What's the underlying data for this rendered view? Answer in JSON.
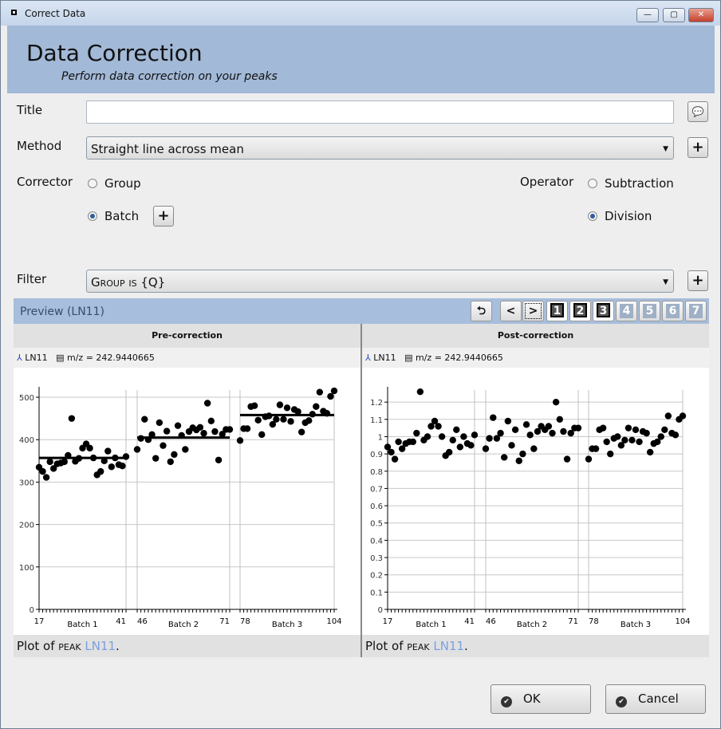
{
  "window": {
    "title": "Correct Data",
    "minimize": "—",
    "maximize": "▢",
    "close": "✕"
  },
  "header": {
    "title": "Data Correction",
    "subtitle": "Perform data correction on your peaks"
  },
  "form": {
    "title_label": "Title",
    "title_value": "",
    "method_label": "Method",
    "method_value": "Straight line across mean",
    "corrector_label": "Corrector",
    "corrector_options": [
      "Group",
      "Batch"
    ],
    "corrector_selected": "Batch",
    "operator_label": "Operator",
    "operator_options": [
      "Subtraction",
      "Division"
    ],
    "operator_selected": "Division",
    "filter_label": "Filter",
    "filter_value": "Group is {Q}"
  },
  "preview": {
    "title": "Preview (LN11)",
    "pages": [
      "1",
      "2",
      "3",
      "4",
      "5",
      "6",
      "7"
    ],
    "enabled_pages": 3
  },
  "panels": [
    {
      "header": "Pre-correction",
      "peak": "LN11",
      "mz": "m/z = 242.9440665",
      "footer_pre": "Plot of ",
      "footer_sc": "peak",
      "footer_link": "LN11",
      "footer_post": "."
    },
    {
      "header": "Post-correction",
      "peak": "LN11",
      "mz": "m/z = 242.9440665",
      "footer_pre": "Plot of ",
      "footer_sc": "peak",
      "footer_link": "LN11",
      "footer_post": "."
    }
  ],
  "buttons": {
    "ok": "OK",
    "cancel": "Cancel"
  },
  "chart_data": [
    {
      "type": "scatter",
      "title": "Pre-correction",
      "ylim": [
        0,
        517
      ],
      "yticks": [
        0,
        100,
        200,
        300,
        400,
        500
      ],
      "grid": true,
      "batches": [
        {
          "label": "Batch 1",
          "x_start": 17,
          "x_end": 41,
          "mean": 357,
          "values": [
            335,
            325,
            311,
            348,
            332,
            343,
            345,
            348,
            363,
            450,
            349,
            356,
            380,
            390,
            380,
            357,
            317,
            325,
            350,
            373,
            336,
            357,
            341,
            338,
            360
          ]
        },
        {
          "label": "Batch 2",
          "x_start": 46,
          "x_end": 71,
          "mean": 405,
          "values": [
            377,
            403,
            448,
            400,
            412,
            356,
            440,
            386,
            420,
            348,
            365,
            433,
            410,
            377,
            419,
            428,
            423,
            429,
            415,
            486,
            444,
            419,
            352,
            413,
            424,
            424
          ]
        },
        {
          "label": "Batch 3",
          "x_start": 78,
          "x_end": 104,
          "mean": 458,
          "values": [
            398,
            426,
            426,
            478,
            480,
            446,
            412,
            454,
            456,
            436,
            448,
            482,
            448,
            475,
            443,
            471,
            466,
            418,
            440,
            445,
            460,
            478,
            512,
            467,
            462,
            502,
            515
          ]
        }
      ]
    },
    {
      "type": "scatter",
      "title": "Post-correction",
      "ylim": [
        0,
        1.27
      ],
      "yticks": [
        0,
        0.1,
        0.2,
        0.3,
        0.4,
        0.5,
        0.6,
        0.7,
        0.8,
        0.9,
        1,
        1.1,
        1.2
      ],
      "grid": true,
      "batches": [
        {
          "label": "Batch 1",
          "x_start": 17,
          "x_end": 41,
          "values": [
            0.94,
            0.91,
            0.87,
            0.97,
            0.93,
            0.96,
            0.97,
            0.97,
            1.02,
            1.26,
            0.98,
            1.0,
            1.06,
            1.09,
            1.06,
            1.0,
            0.89,
            0.91,
            0.98,
            1.04,
            0.94,
            1.0,
            0.96,
            0.95,
            1.01
          ]
        },
        {
          "label": "Batch 2",
          "x_start": 46,
          "x_end": 71,
          "values": [
            0.93,
            0.99,
            1.11,
            0.99,
            1.02,
            0.88,
            1.09,
            0.95,
            1.04,
            0.86,
            0.9,
            1.07,
            1.01,
            0.93,
            1.03,
            1.06,
            1.04,
            1.06,
            1.02,
            1.2,
            1.1,
            1.03,
            0.87,
            1.02,
            1.05,
            1.05
          ]
        },
        {
          "label": "Batch 3",
          "x_start": 78,
          "x_end": 104,
          "values": [
            0.87,
            0.93,
            0.93,
            1.04,
            1.05,
            0.97,
            0.9,
            0.99,
            1.0,
            0.95,
            0.98,
            1.05,
            0.98,
            1.04,
            0.97,
            1.03,
            1.02,
            0.91,
            0.96,
            0.97,
            1.0,
            1.04,
            1.12,
            1.02,
            1.01,
            1.1,
            1.12
          ]
        }
      ]
    }
  ]
}
